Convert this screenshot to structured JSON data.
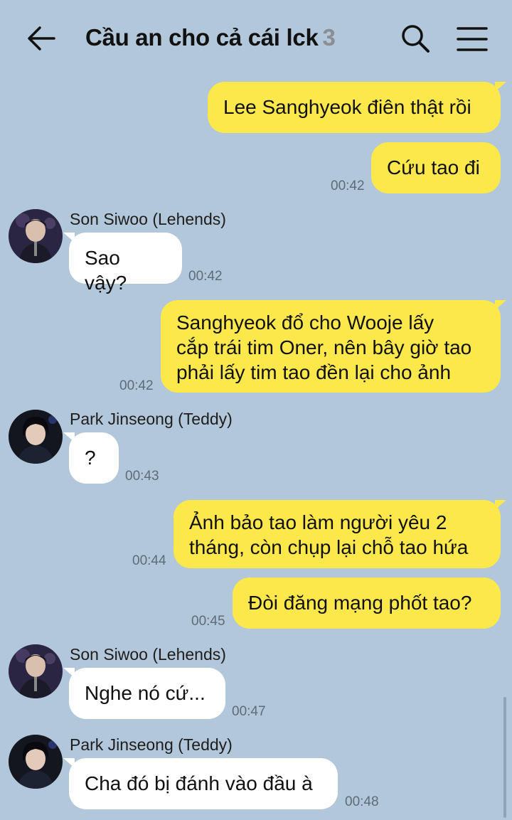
{
  "header": {
    "title": "Cầu an cho cả cái lck",
    "member_count": "3",
    "back_icon": "arrow-left-icon",
    "search_icon": "search-icon",
    "menu_icon": "hamburger-menu-icon"
  },
  "colors": {
    "background": "#b2c7da",
    "outgoing_bubble": "#fde84b",
    "incoming_bubble": "#ffffff"
  },
  "messages": [
    {
      "direction": "out",
      "text": "Lee Sanghyeok điên thật rồi",
      "time": ""
    },
    {
      "direction": "out",
      "text": "Cứu tao đi",
      "time": "00:42"
    },
    {
      "direction": "in",
      "sender": "Son Siwoo (Lehends)",
      "text": "Sao vậy?",
      "time": "00:42"
    },
    {
      "direction": "out",
      "lines": [
        "Sanghyeok đổ cho Wooje lấy",
        "cắp trái tim Oner, nên bây giờ tao",
        "phải lấy tim tao đền lại cho ảnh"
      ],
      "time": "00:42"
    },
    {
      "direction": "in",
      "sender": "Park Jinseong (Teddy)",
      "text": "?",
      "time": "00:43"
    },
    {
      "direction": "out",
      "lines": [
        "Ảnh bảo tao làm người yêu 2",
        "tháng, còn chụp lại chỗ tao hứa"
      ],
      "time": "00:44"
    },
    {
      "direction": "out",
      "text": "Đòi đăng mạng phốt tao?",
      "time": "00:45"
    },
    {
      "direction": "in",
      "sender": "Son Siwoo (Lehends)",
      "text": "Nghe nó cứ...",
      "time": "00:47"
    },
    {
      "direction": "in",
      "sender": "Park Jinseong (Teddy)",
      "text": "Cha đó bị đánh vào đầu à",
      "time": "00:48"
    }
  ]
}
